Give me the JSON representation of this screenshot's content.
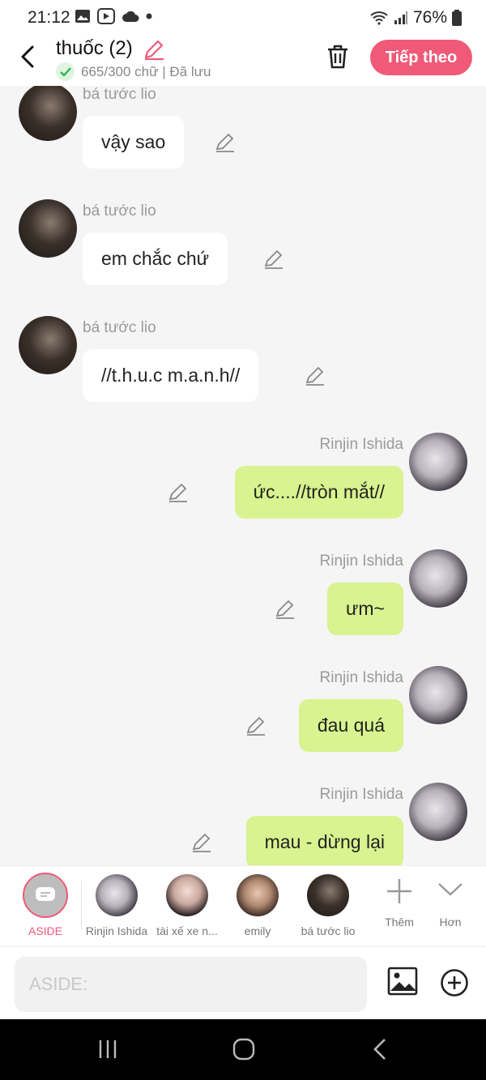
{
  "status": {
    "time": "21:12",
    "battery": "76%"
  },
  "header": {
    "title": "thuốc (2)",
    "subtitle": "665/300 chữ | Đã lưu",
    "next_label": "Tiếp theo"
  },
  "messages": [
    {
      "sender": "bá tước lio",
      "text": "vậy sao"
    },
    {
      "sender": "bá tước lio",
      "text": "em chắc chứ"
    },
    {
      "sender": "bá tước lio",
      "text": "//t.h.u.c m.a.n.h//"
    },
    {
      "sender": "Rinjin Ishida",
      "text": "ức....//tròn mắt//"
    },
    {
      "sender": "Rinjin Ishida",
      "text": "ưm~"
    },
    {
      "sender": "Rinjin Ishida",
      "text": "đau quá"
    },
    {
      "sender": "Rinjin Ishida",
      "text": "mau - dừng lại"
    }
  ],
  "characters": [
    {
      "label": "ASIDE"
    },
    {
      "label": "Rinjin Ishida"
    },
    {
      "label": "tài xế xe n..."
    },
    {
      "label": "emily"
    },
    {
      "label": "bá tước lio"
    },
    {
      "label": "Thêm"
    },
    {
      "label": "Hơn"
    }
  ],
  "input": {
    "placeholder": "ASIDE:"
  },
  "colors": {
    "accent": "#f05a78",
    "right_bubble": "#d8f38f",
    "left_bubble": "#ffffff"
  }
}
